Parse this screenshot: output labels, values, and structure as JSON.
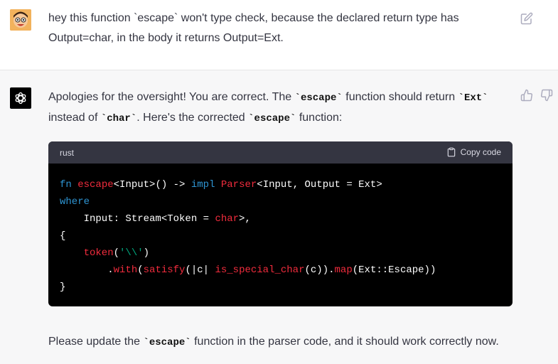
{
  "user_message": {
    "text": "hey this function `escape` won't type check, because the declared return type has Output=char, in the body it returns Output=Ext."
  },
  "assistant_message": {
    "p1_a": "Apologies for the oversight! You are correct. The ",
    "p1_code1": "`escape`",
    "p1_b": " function should return ",
    "p1_code2": "`Ext`",
    "p1_c": " instead of ",
    "p1_code3": "`char`",
    "p1_d": ". Here's the corrected ",
    "p1_code4": "`escape`",
    "p1_e": " function:",
    "p2_a": "Please update the ",
    "p2_code": "`escape`",
    "p2_b": " function in the parser code, and it should work correctly now."
  },
  "code_block": {
    "language": "rust",
    "copy_label": "Copy code",
    "tokens": {
      "l1_fn": "fn",
      "l1_sp": " ",
      "l1_name": "escape",
      "l1_a": "<Input>() -> ",
      "l1_impl": "impl",
      "l1_sp2": " ",
      "l1_parser": "Parser",
      "l1_b": "<Input, Output = Ext>",
      "l2_where": "where",
      "l3_a": "    Input: Stream<Token = ",
      "l3_char": "char",
      "l3_b": ">,",
      "l4": "{",
      "l5_token": "    token",
      "l5_a": "(",
      "l5_str": "'\\\\'",
      "l5_b": ")",
      "l6_a": "        .",
      "l6_with": "with",
      "l6_b": "(",
      "l6_satisfy": "satisfy",
      "l6_c": "(|c| ",
      "l6_isc": "is_special_char",
      "l6_d": "(c)).",
      "l6_map": "map",
      "l6_e": "(Ext::Escape))",
      "l7": "}"
    }
  },
  "icons": {
    "edit": "edit-icon",
    "thumbs_up": "thumbs-up-icon",
    "thumbs_down": "thumbs-down-icon",
    "copy": "clipboard-icon",
    "assistant_logo": "openai-logo-icon",
    "user_avatar": "user-avatar"
  },
  "colors": {
    "keyword": "#2e95d3",
    "function": "#f22c3d",
    "string": "#00a67d",
    "code_bg": "#000000",
    "code_header_bg": "#343541",
    "assistant_bg": "#f7f7f8"
  }
}
